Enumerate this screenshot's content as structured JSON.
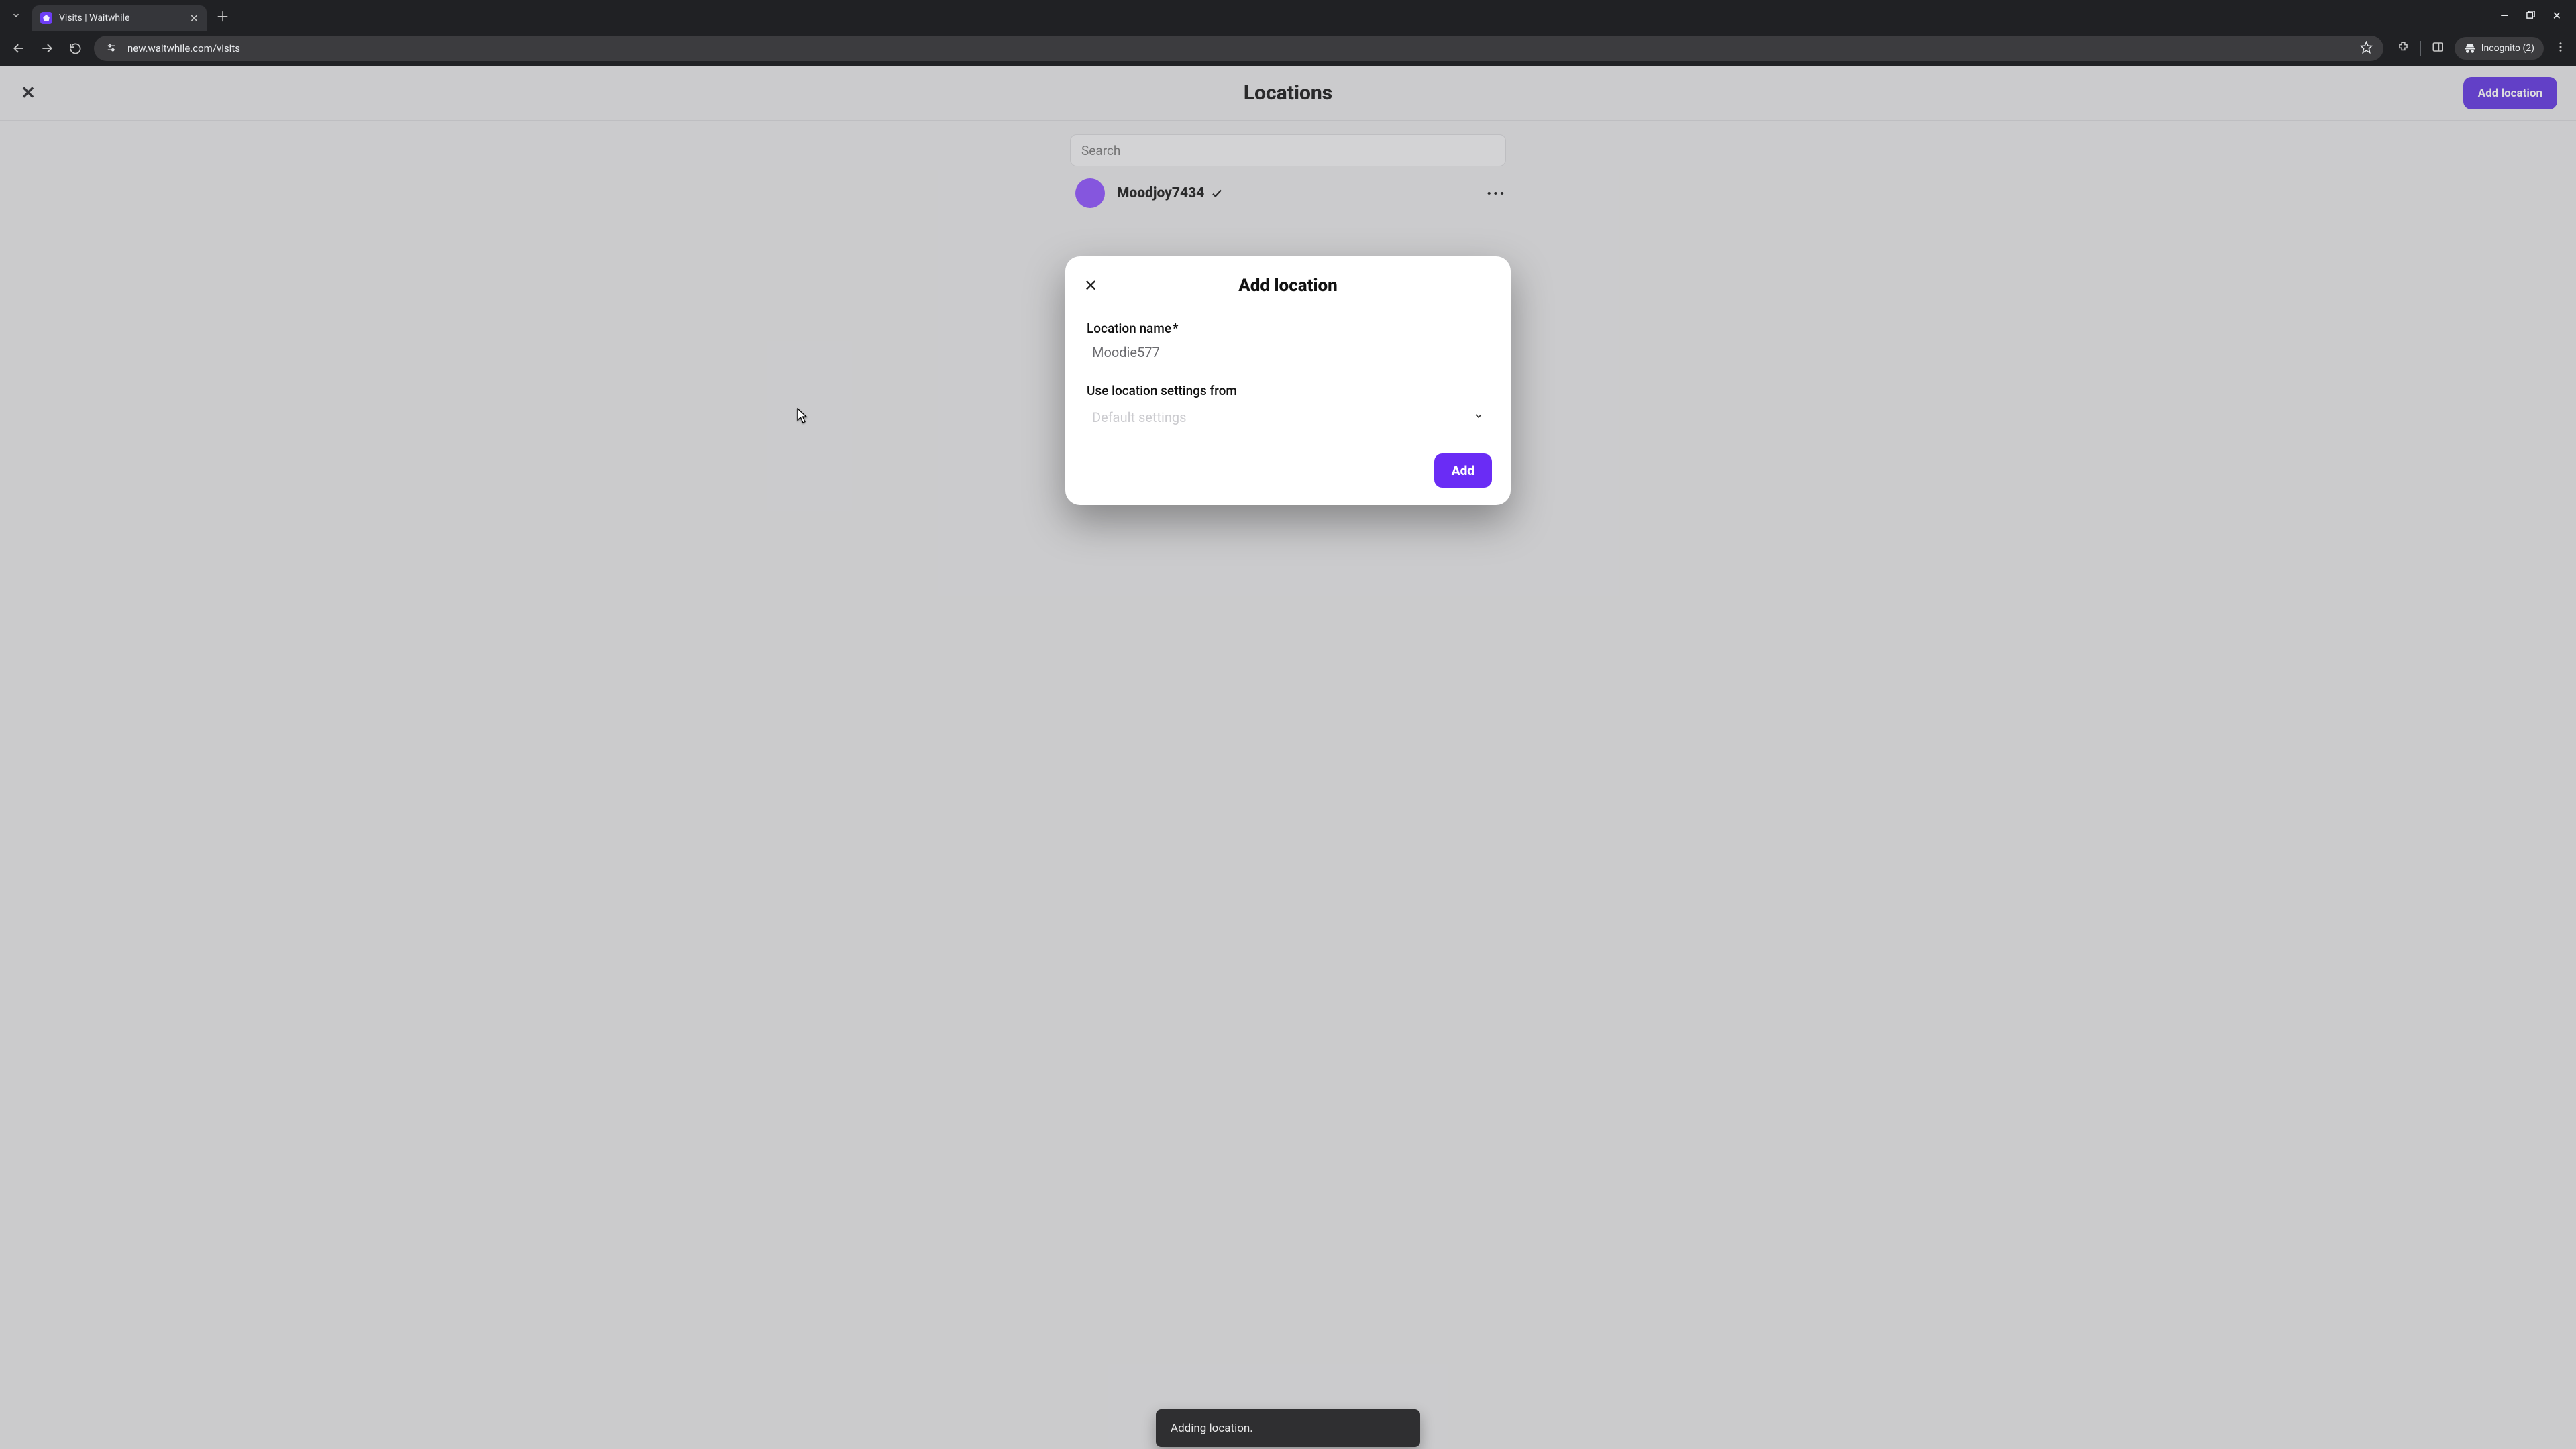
{
  "browser": {
    "tab_title": "Visits | Waitwhile",
    "url": "new.waitwhile.com/visits",
    "incognito_label": "Incognito (2)"
  },
  "page": {
    "title": "Locations",
    "add_location_button": "Add location",
    "search_placeholder": "Search",
    "location_item": {
      "name": "Moodjoy7434"
    }
  },
  "modal": {
    "title": "Add location",
    "location_name_label": "Location name",
    "required_mark": "*",
    "location_name_value": "Moodie577",
    "settings_from_label": "Use location settings from",
    "settings_from_value": "Default settings",
    "add_button": "Add"
  },
  "toast": {
    "message": "Adding location."
  },
  "colors": {
    "brand_accent": "#5b2ee0",
    "modal_accent": "#6a2cf5",
    "browser_bg": "#202124",
    "viewport_bg": "#e7e7e8"
  }
}
